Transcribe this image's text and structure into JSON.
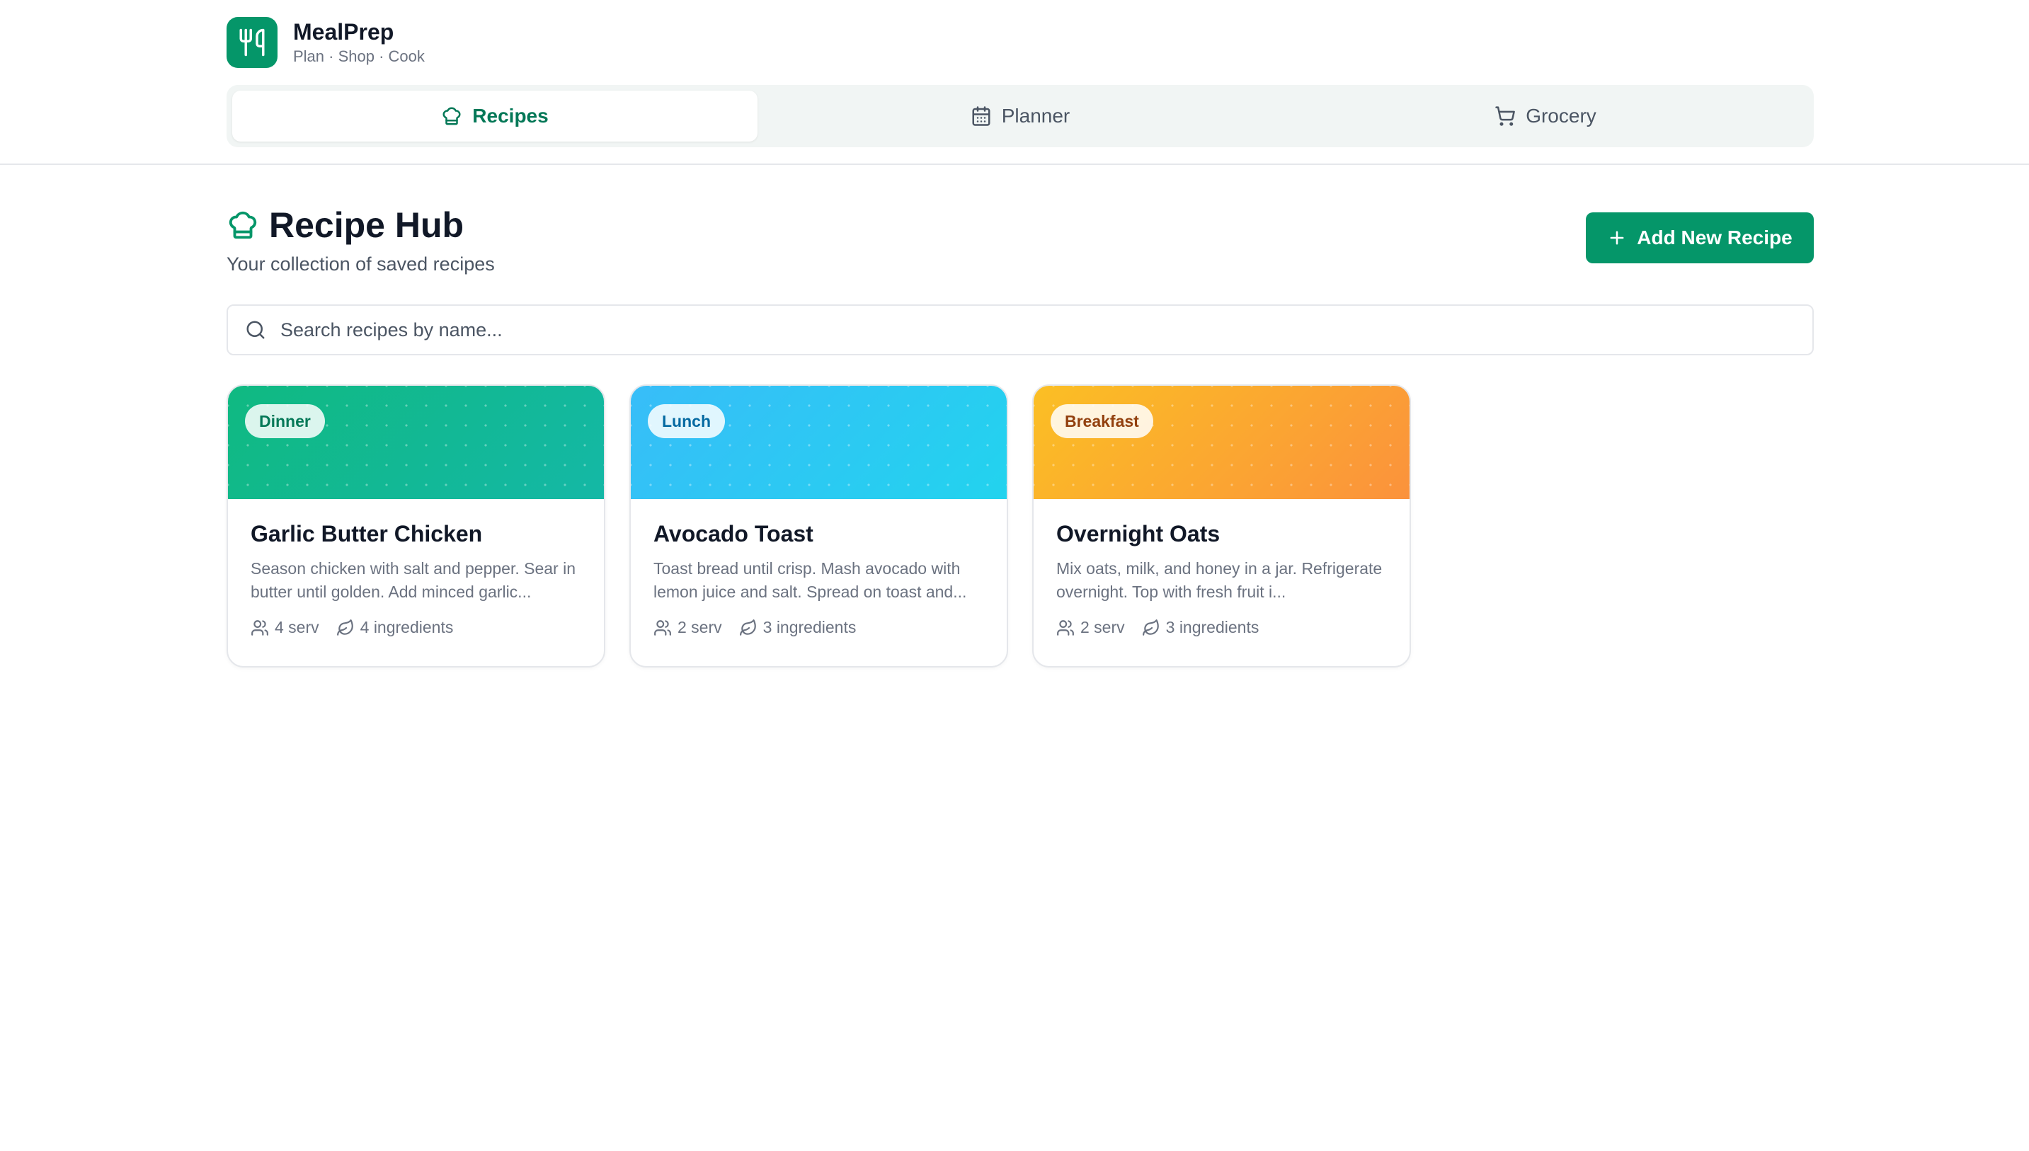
{
  "app": {
    "name": "MealPrep",
    "tagline": "Plan · Shop · Cook",
    "logo_icon": "utensils-icon",
    "accent_color": "#059669"
  },
  "tabs": [
    {
      "label": "Recipes",
      "icon": "chef-hat-icon",
      "active": true
    },
    {
      "label": "Planner",
      "icon": "calendar-icon",
      "active": false
    },
    {
      "label": "Grocery",
      "icon": "shopping-cart-icon",
      "active": false
    }
  ],
  "page": {
    "title": "Recipe Hub",
    "title_icon": "chef-hat-icon",
    "subtitle": "Your collection of saved recipes",
    "add_button_label": "Add New Recipe"
  },
  "search": {
    "placeholder": "Search recipes by name...",
    "value": ""
  },
  "recipes": [
    {
      "category": "Dinner",
      "title": "Garlic Butter Chicken",
      "description": "Season chicken with salt and pepper. Sear in butter until golden. Add minced garlic...",
      "servings": "4 serv",
      "ingredients": "4 ingredients",
      "color": "#10b981"
    },
    {
      "category": "Lunch",
      "title": "Avocado Toast",
      "description": "Toast bread until crisp. Mash avocado with lemon juice and salt. Spread on toast and...",
      "servings": "2 serv",
      "ingredients": "3 ingredients",
      "color": "#38bdf8"
    },
    {
      "category": "Breakfast",
      "title": "Overnight Oats",
      "description": "Mix oats, milk, and honey in a jar. Refrigerate overnight. Top with fresh fruit i...",
      "servings": "2 serv",
      "ingredients": "3 ingredients",
      "color": "#fbbf24"
    }
  ]
}
